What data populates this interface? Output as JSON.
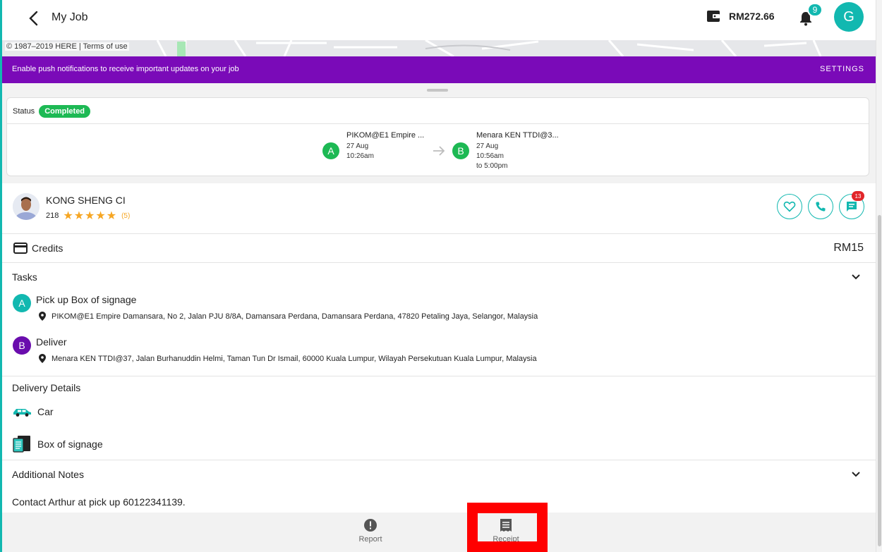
{
  "header": {
    "title": "My Job",
    "wallet_amount": "RM272.66",
    "notification_count": "9",
    "avatar_letter": "G",
    "icons": [
      "back-arrow-icon",
      "wallet-icon",
      "bell-icon"
    ]
  },
  "map": {
    "copyright": "© 1987–2019 HERE | Terms of use"
  },
  "notification_bar": {
    "text": "Enable push notifications to receive important updates on your job",
    "settings_label": "SETTINGS"
  },
  "status": {
    "label": "Status",
    "value": "Completed",
    "pickup": {
      "letter": "A",
      "name": "PIKOM@E1 Empire ...",
      "date": "27 Aug",
      "time": "10:26am"
    },
    "dropoff": {
      "letter": "B",
      "name": "Menara KEN TTDI@3...",
      "date": "27 Aug",
      "time": "10:56am",
      "time_to": "to 5:00pm"
    }
  },
  "driver": {
    "name": "KONG SHENG CI",
    "trips": "218",
    "stars": "★★★★★",
    "rating_count": "(5)",
    "chat_badge": "13",
    "icons": [
      "heart-icon",
      "phone-icon",
      "chat-icon"
    ]
  },
  "credits": {
    "label": "Credits",
    "value": "RM15"
  },
  "tasks": {
    "title": "Tasks",
    "items": [
      {
        "letter": "A",
        "title": "Pick up Box of signage",
        "address": "PIKOM@E1 Empire Damansara, No 2, Jalan PJU 8/8A, Damansara Perdana, Damansara Perdana, 47820 Petaling Jaya, Selangor, Malaysia",
        "color": "#12b8b0"
      },
      {
        "letter": "B",
        "title": "Deliver",
        "address": "Menara KEN TTDI@37, Jalan Burhanuddin Helmi, Taman Tun Dr Ismail, 60000 Kuala Lumpur, Wilayah Persekutuan Kuala Lumpur, Malaysia",
        "color": "#6a0dad"
      }
    ]
  },
  "delivery_details": {
    "title": "Delivery Details",
    "vehicle": "Car",
    "item": "Box of signage"
  },
  "notes": {
    "title": "Additional Notes",
    "text": "Contact Arthur at pick up 60122341139."
  },
  "bottom_bar": {
    "report_label": "Report",
    "receipt_label": "Receipt"
  },
  "colors": {
    "accent": "#12b8b0",
    "purple": "#7a0ab8",
    "green": "#1db954",
    "star": "#f6a623",
    "highlight": "#ff0000"
  }
}
